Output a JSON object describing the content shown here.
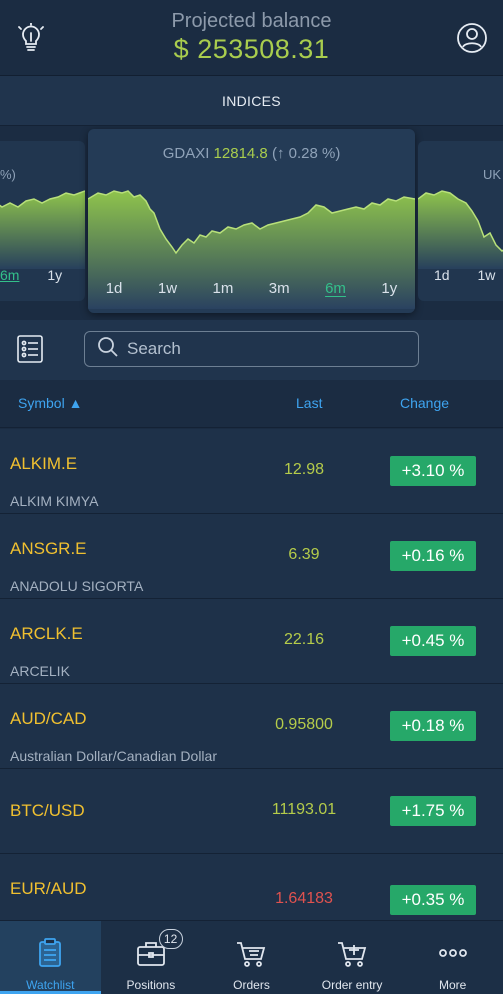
{
  "header": {
    "balance_label": "Projected balance",
    "balance_value": "$ 253508.31",
    "left_icon": "lightbulb-icon",
    "right_icon": "user-profile-icon"
  },
  "indices": {
    "title": "INDICES"
  },
  "carousel": {
    "main": {
      "name": "GDAXI",
      "value": "12814.8",
      "change": "(↑ 0.28 %)",
      "periods": [
        "1d",
        "1w",
        "1m",
        "3m",
        "6m",
        "1y"
      ],
      "active_period": "6m"
    },
    "left_partial": {
      "title": "%)",
      "periods": [
        "6m",
        "1y"
      ]
    },
    "right_partial": {
      "title": "UK",
      "periods": [
        "1d",
        "1w"
      ]
    }
  },
  "search": {
    "placeholder": "Search"
  },
  "columns": {
    "symbol": "Symbol ▲",
    "last": "Last",
    "change": "Change"
  },
  "rows": [
    {
      "symbol": "ALKIM.E",
      "name": "ALKIM KIMYA",
      "last": "12.98",
      "change": "+3.10 %"
    },
    {
      "symbol": "ANSGR.E",
      "name": "ANADOLU SIGORTA",
      "last": "6.39",
      "change": "+0.16 %"
    },
    {
      "symbol": "ARCLK.E",
      "name": "ARCELIK",
      "last": "22.16",
      "change": "+0.45 %"
    },
    {
      "symbol": "AUD/CAD",
      "name": "Australian Dollar/Canadian Dollar",
      "last": "0.95800",
      "change": "+0.18 %"
    },
    {
      "symbol": "BTC/USD",
      "name": "",
      "last": "11193.01",
      "change": "+1.75 %"
    },
    {
      "symbol": "EUR/AUD",
      "name": "",
      "last": "1.64183",
      "change": "+0.35 %"
    }
  ],
  "colors": {
    "accent": "#3ea4f0",
    "positive": "#26a869",
    "symbol": "#f0c030",
    "price_up": "#b5cc4a",
    "price_down": "#e0524f"
  },
  "nav": {
    "items": [
      {
        "label": "Watchlist",
        "icon": "clipboard-icon"
      },
      {
        "label": "Positions",
        "icon": "briefcase-icon"
      },
      {
        "label": "Orders",
        "icon": "cart-list-icon"
      },
      {
        "label": "Order entry",
        "icon": "cart-add-icon"
      },
      {
        "label": "More",
        "icon": "more-dots-icon"
      }
    ],
    "positions_badge": "12"
  }
}
